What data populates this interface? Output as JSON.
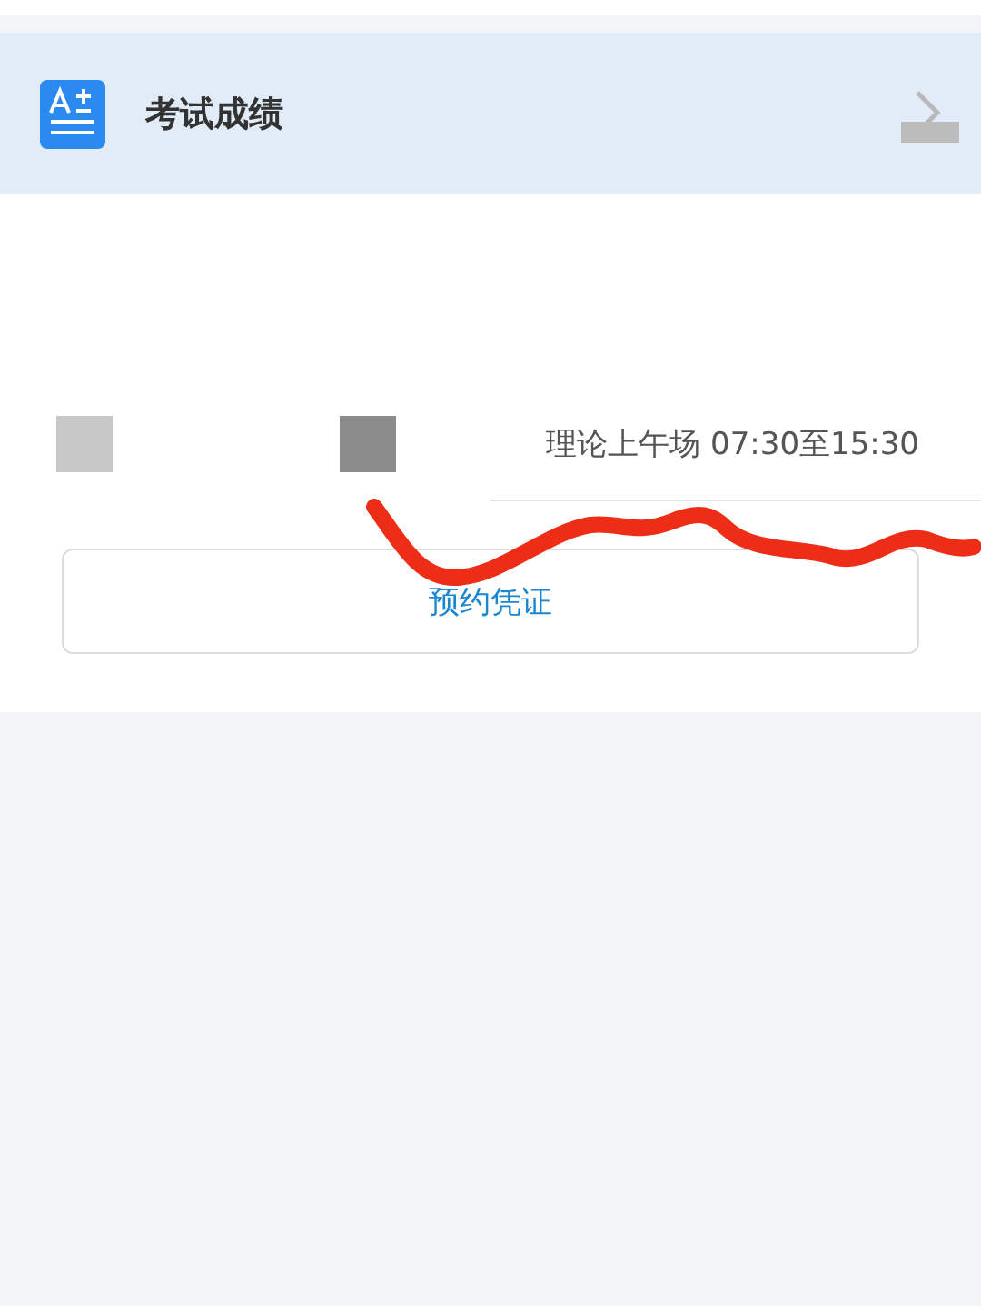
{
  "header": {
    "title": "考试成绩"
  },
  "exam": {
    "session": "理论上午场 07:30至15:30",
    "button": "预约凭证"
  }
}
